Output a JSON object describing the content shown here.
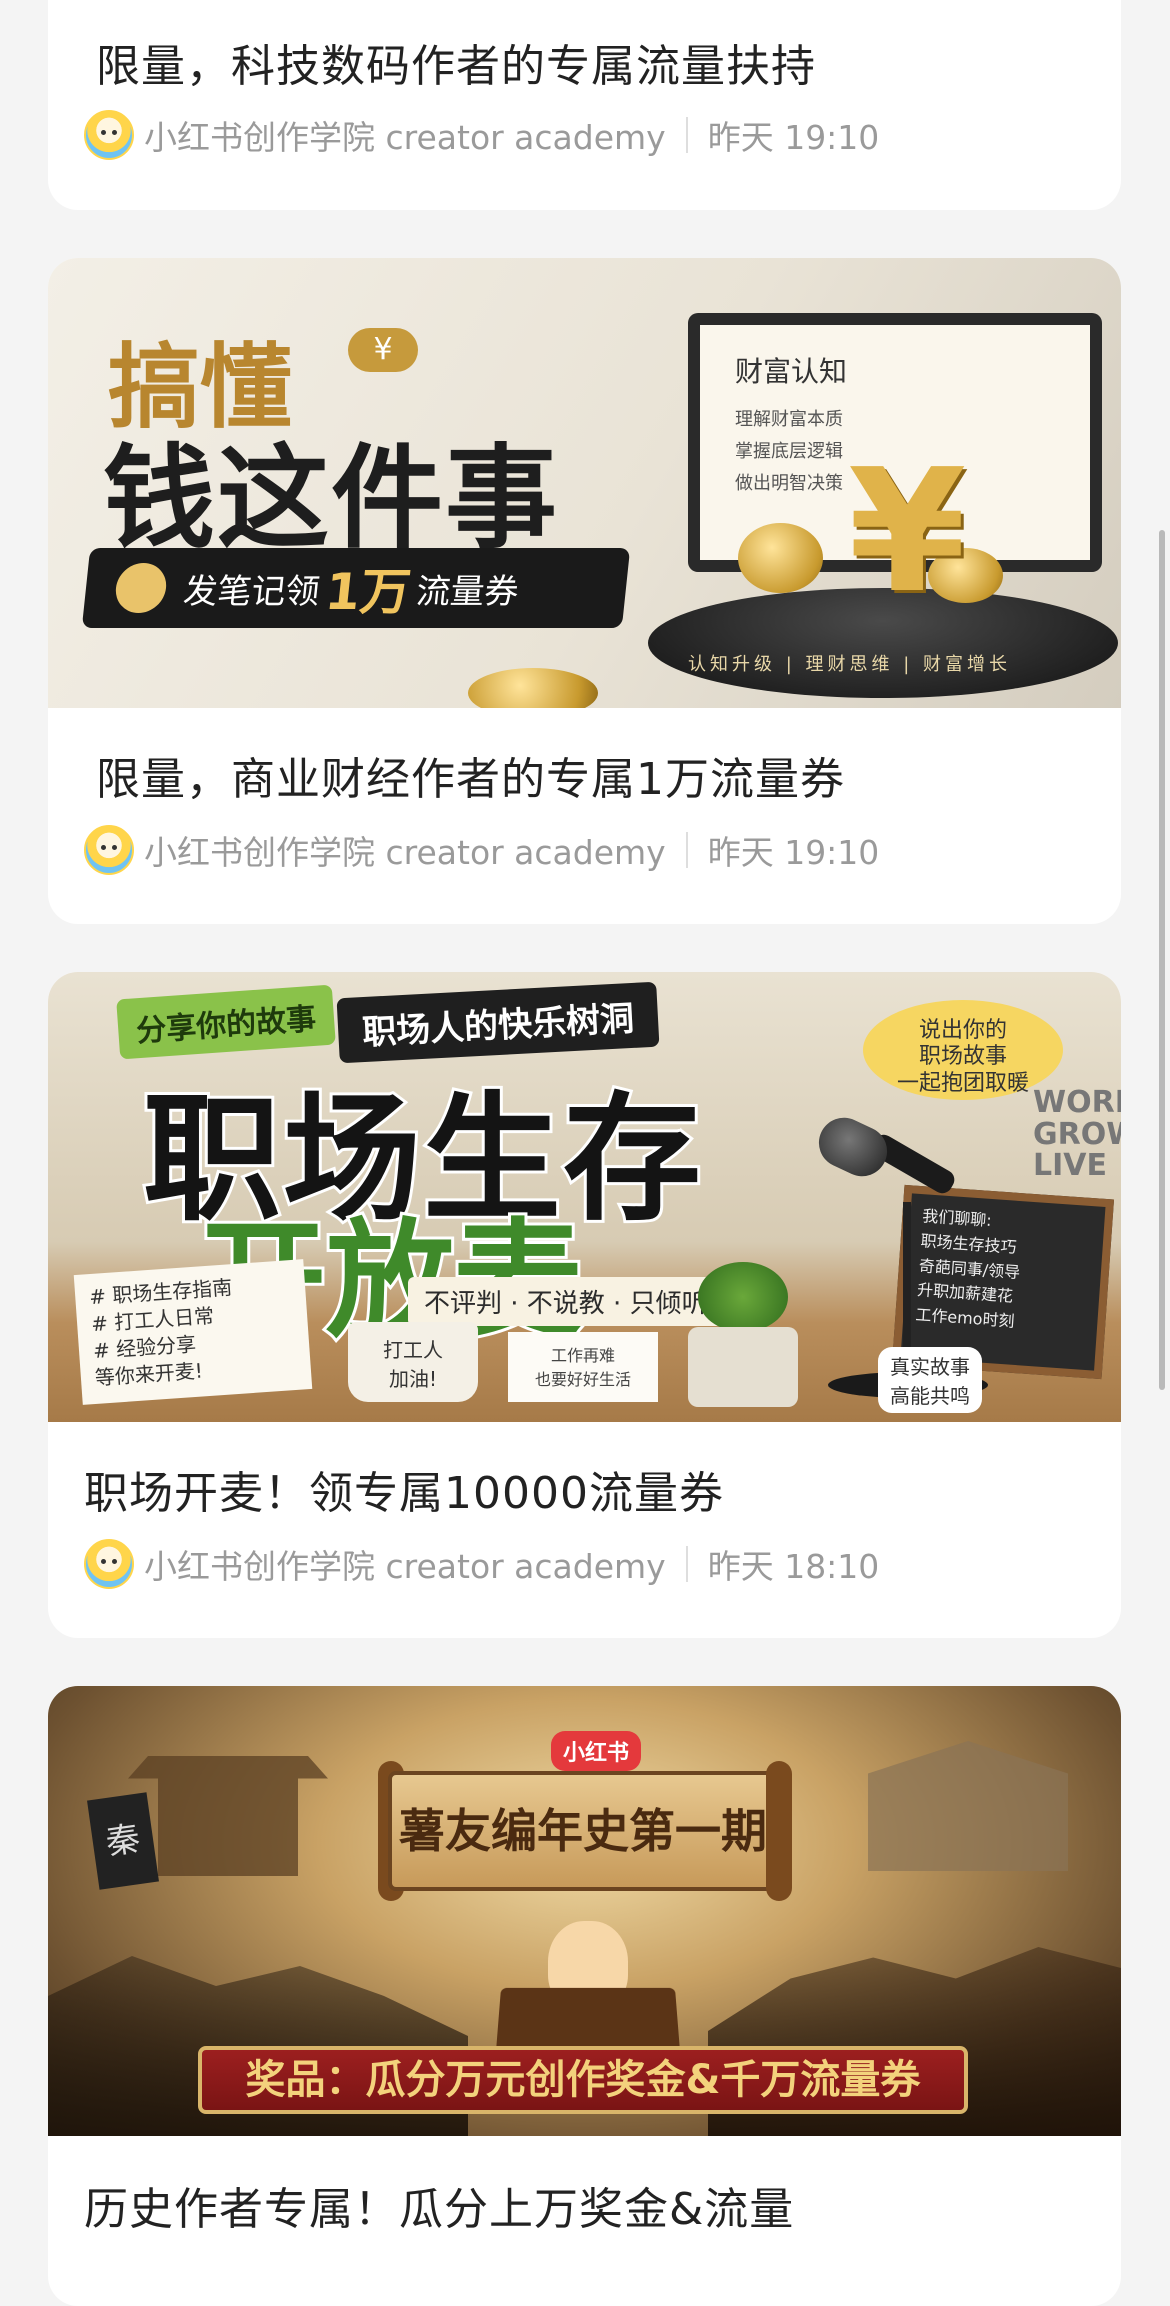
{
  "cards": [
    {
      "title": "限量，科技数码作者的专属流量扶持",
      "author": "小红书创作学院 creator academy",
      "time": "昨天 19:10"
    },
    {
      "title": "限量，商业财经作者的专属1万流量券",
      "author": "小红书创作学院 creator academy",
      "time": "昨天 19:10",
      "banner": {
        "line1": "搞懂",
        "line2": "钱这件事",
        "yen_bubble": "¥",
        "pill_prefix": "发笔记领",
        "pill_big": "1万",
        "pill_suffix": "流量券",
        "book_title": "财富认知",
        "book_lines": [
          "理解财富本质",
          "掌握底层逻辑",
          "做出明智决策"
        ],
        "pedestal_text": "认知升级 | 理财思维 | 财富增长",
        "yen_symbol": "¥",
        "accent": "#b8862f"
      }
    },
    {
      "title": "职场开麦！领专属10000流量券",
      "author": "小红书创作学院 creator academy",
      "time": "昨天 18:10",
      "banner": {
        "tag1": "分享你的故事",
        "tag2": "职场人的快乐树洞",
        "big1": "职场生存",
        "big2": "开放麦",
        "sub": "不评判 · 不说教 · 只倾听",
        "note": "# 职场生存指南\n# 打工人日常\n# 经验分享\n等你来开麦!",
        "bubble": "说出你的\n职场故事\n一起抱团取暖",
        "wall": "WORK\nGROW\nLIVE",
        "board": "我们聊聊:\n职场生存技巧\n奇葩同事/领导\n升职加薪建花\n工作emo时刻",
        "mug": "打工人\n加油!",
        "card": "工作再难\n也要好好生活",
        "stamp": "真实故事\n高能共鸣",
        "green": "#3f8a2a"
      }
    },
    {
      "title": "历史作者专属！瓜分上万奖金&流量",
      "banner": {
        "logo": "小红书",
        "scroll": "薯友编年史第一期",
        "flag": "秦",
        "prize": "奖品：瓜分万元创作奖金&千万流量券"
      }
    }
  ]
}
